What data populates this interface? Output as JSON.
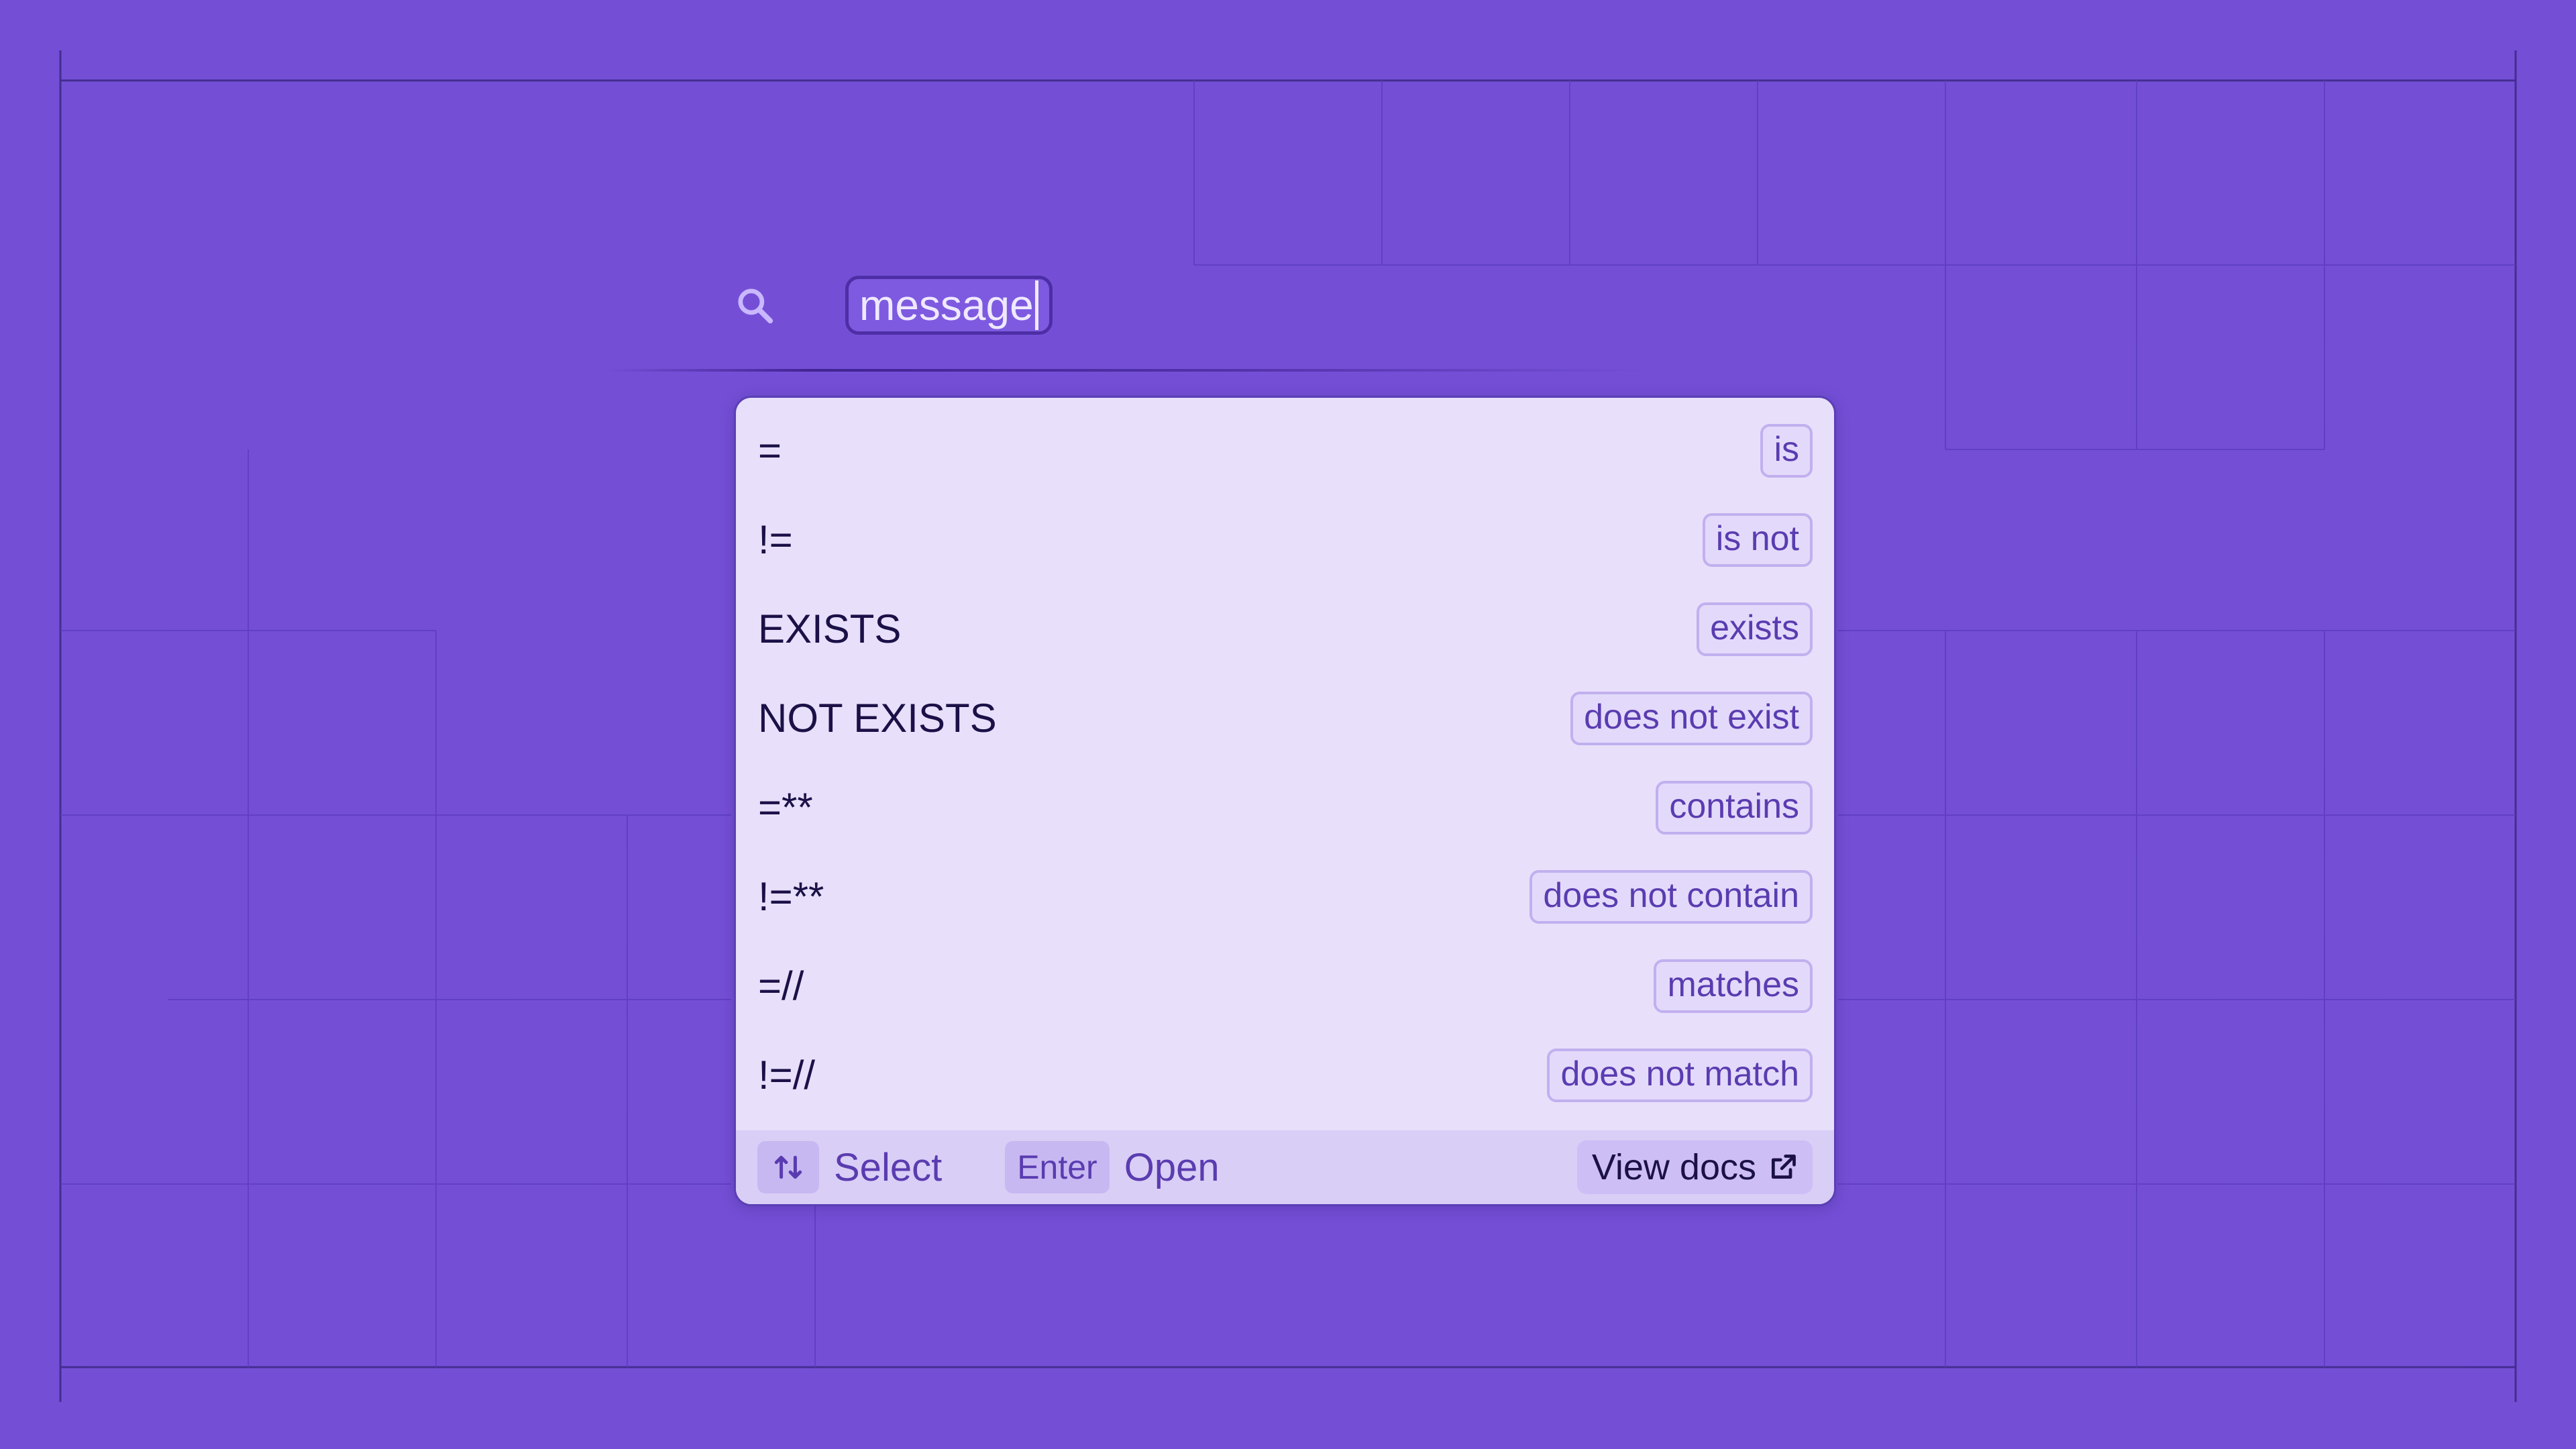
{
  "search": {
    "value": "message"
  },
  "operators": [
    {
      "op": "=",
      "label": "is"
    },
    {
      "op": "!=",
      "label": "is not"
    },
    {
      "op": "EXISTS",
      "label": "exists"
    },
    {
      "op": "NOT EXISTS",
      "label": "does not exist"
    },
    {
      "op": "=**",
      "label": "contains"
    },
    {
      "op": "!=**",
      "label": "does not contain"
    },
    {
      "op": "=//",
      "label": "matches"
    },
    {
      "op": "!=//",
      "label": "does not match"
    }
  ],
  "footer": {
    "select_label": "Select",
    "enter_key": "Enter",
    "open_label": "Open",
    "docs_label": "View docs"
  },
  "colors": {
    "background": "#744fd6",
    "dropdown": "#e8e0fb",
    "accent": "#5a3cb0"
  },
  "icons": {
    "search": "search-icon",
    "arrows": "up-down-arrows-icon",
    "external": "external-link-icon"
  }
}
